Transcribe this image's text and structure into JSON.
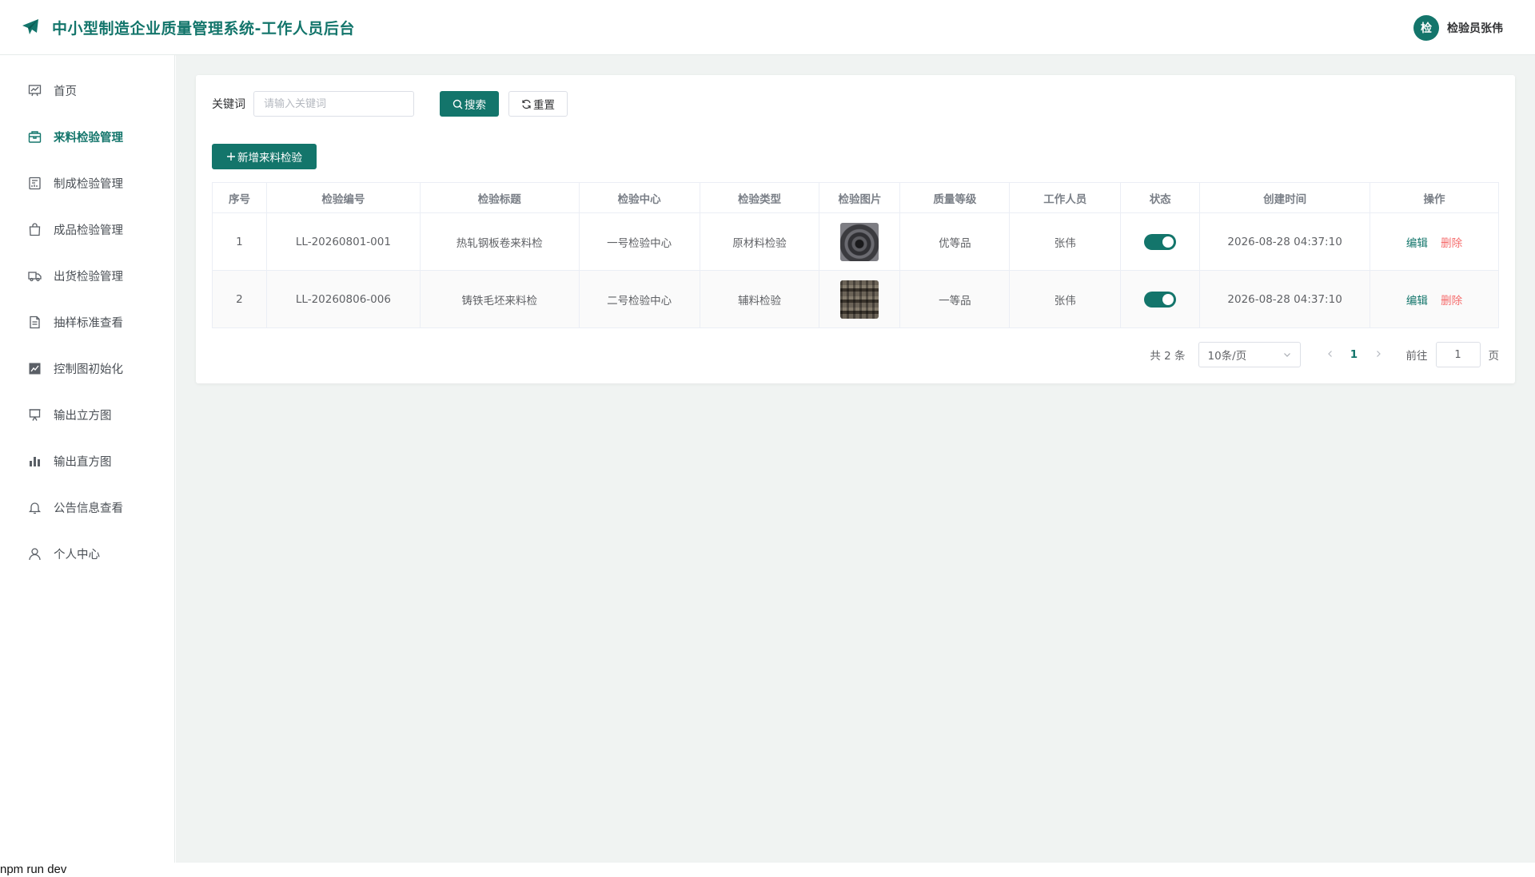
{
  "header": {
    "title": "中小型制造企业质量管理系统-工作人员后台",
    "avatar_text": "检",
    "user_name": "检验员张伟",
    "brand_color": "#13756b"
  },
  "sidebar": {
    "items": [
      {
        "label": "首页",
        "icon": "chart-board-icon",
        "active": false
      },
      {
        "label": "来料检验管理",
        "icon": "package-icon",
        "active": true
      },
      {
        "label": "制成检验管理",
        "icon": "document-chart-icon",
        "active": false
      },
      {
        "label": "成品检验管理",
        "icon": "shopping-bag-icon",
        "active": false
      },
      {
        "label": "出货检验管理",
        "icon": "truck-icon",
        "active": false
      },
      {
        "label": "抽样标准查看",
        "icon": "document-icon",
        "active": false
      },
      {
        "label": "控制图初始化",
        "icon": "line-chart-icon",
        "active": false
      },
      {
        "label": "输出立方图",
        "icon": "presentation-icon",
        "active": false
      },
      {
        "label": "输出直方图",
        "icon": "bar-chart-icon",
        "active": false
      },
      {
        "label": "公告信息查看",
        "icon": "bell-icon",
        "active": false
      },
      {
        "label": "个人中心",
        "icon": "user-icon",
        "active": false
      }
    ]
  },
  "search": {
    "label": "关键词",
    "placeholder": "请输入关键词",
    "value": "",
    "search_label": "搜索",
    "reset_label": "重置"
  },
  "toolbar": {
    "add_label": "新增来料检验"
  },
  "table": {
    "columns": [
      "序号",
      "检验编号",
      "检验标题",
      "检验中心",
      "检验类型",
      "检验图片",
      "质量等级",
      "工作人员",
      "状态",
      "创建时间",
      "操作"
    ],
    "rows": [
      {
        "index": "1",
        "code": "LL-20260801-001",
        "title": "热轧钢板卷来料检",
        "center": "一号检验中心",
        "type": "原材料检验",
        "image": "steel-coil",
        "grade": "优等品",
        "staff": "张伟",
        "status": true,
        "created": "2026-08-28 04:37:10"
      },
      {
        "index": "2",
        "code": "LL-20260806-006",
        "title": "铸铁毛坯来料检",
        "center": "二号检验中心",
        "type": "辅料检验",
        "image": "cast-iron-blanks",
        "grade": "一等品",
        "staff": "张伟",
        "status": true,
        "created": "2026-08-28 04:37:10"
      }
    ],
    "edit_label": "编辑",
    "delete_label": "删除"
  },
  "pagination": {
    "total_text": "共 2 条",
    "page_size": "10条/页",
    "current_page": "1",
    "goto_label": "前往",
    "goto_value": "1",
    "unit_label": "页"
  },
  "terminal": {
    "text": "npm run dev"
  }
}
